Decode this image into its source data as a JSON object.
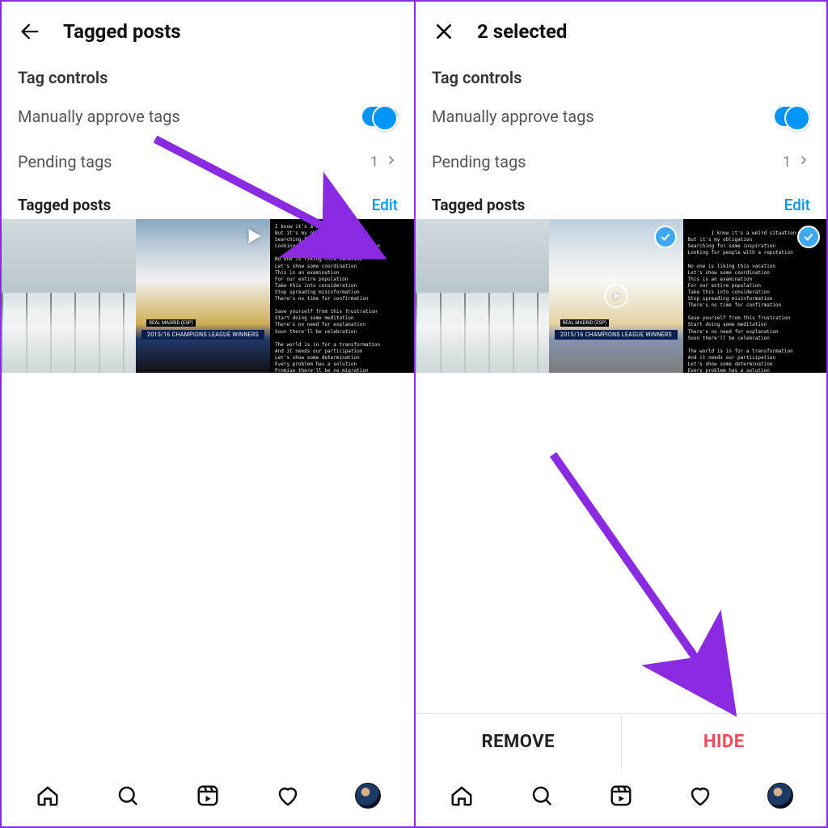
{
  "left": {
    "header_title": "Tagged posts",
    "section": "Tag controls",
    "approve_label": "Manually approve tags",
    "pending_label": "Pending tags",
    "pending_count": "1",
    "tagged_header": "Tagged posts",
    "edit_label": "Edit",
    "stadium_tag": "REAL MADRID (ESP)",
    "stadium_banner": "2015/16 CHAMPIONS LEAGUE WINNERS",
    "lyrics": "I know it's a weird situation\nBut it's my obligation\nSearching for some inspiration\nLooking for people with a reputation\n\nNo one is liking this vacation\nLet's show some coordination\nThis is an examination\nFor our entire population\nTake this into consideration\nStop spreading misinformation\nThere's no time for confirmation\n\nSave yourself from this frustration\nStart doing some meditation\nThere's no need for explanation\nSoon there'll be celebration\n\nThe world is in for a transformation\nAnd it needs our participation\nLet's show some determination\nEvery problem has a solution\nPromise there'll be no migration\nTill we reach desired inflation\nThere's still hope for this generation\nNeed a little more dedication\nIt's a simple calculation\nStep in before saturation\nMay there be no complication\n\nHope you like my new narration\nThis song is a small donation\nWell you need proof or validation?\nOh yes this is my creation\nBut please don't think of duplication"
  },
  "right": {
    "header_title": "2 selected",
    "section": "Tag controls",
    "approve_label": "Manually approve tags",
    "pending_label": "Pending tags",
    "pending_count": "1",
    "tagged_header": "Tagged posts",
    "edit_label": "Edit",
    "stadium_tag": "REAL MADRID (ESP)",
    "stadium_banner": "2015/16 CHAMPIONS LEAGUE WINNERS",
    "lyrics": "I know it's a weird situation\nBut it's my obligation\nSearching for some inspiration\nLooking for people with a reputation\n\nNo one is liking this vacation\nLet's show some coordination\nThis is an examination\nFor our entire population\nTake this into consideration\nStop spreading misinformation\nThere's no time for confirmation\n\nSave yourself from this frustration\nStart doing some meditation\nThere's no need for explanation\nSoon there'll be celebration\n\nThe world is in for a transformation\nAnd it needs our participation\nLet's show some determination\nEvery problem has a solution\nPromise there'll be no migration\nTill we reach desired inflation\nThere's still hope for this generation\nNeed a little more dedication\nIt's a simple calculation\nStep in before saturation\nMay there be no complication\n\nHope you like my new narration\nThis song is a small donation\nWell you need proof or validation?\nOh yes this is my creation\nBut please don't think of duplication",
    "remove_label": "REMOVE",
    "hide_label": "HIDE"
  }
}
